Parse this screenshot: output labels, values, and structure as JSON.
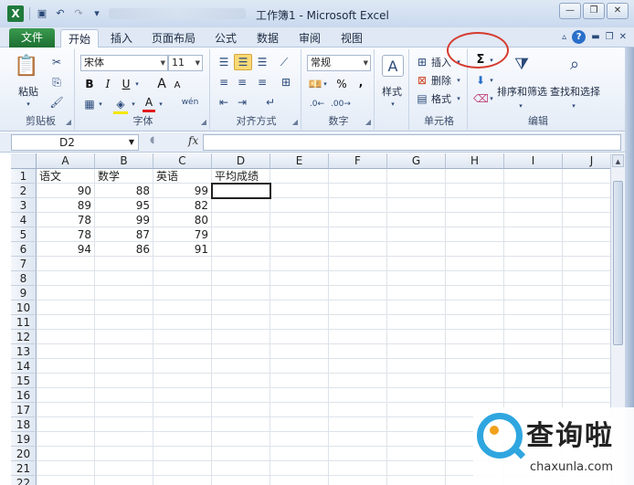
{
  "window": {
    "title": "工作簿1 - Microsoft Excel",
    "app_icon": "X",
    "controls": {
      "minimize": "—",
      "restore": "❐",
      "close": "✕"
    }
  },
  "tabs": {
    "file": "文件",
    "items": [
      "开始",
      "插入",
      "页面布局",
      "公式",
      "数据",
      "审阅",
      "视图"
    ],
    "active": "开始"
  },
  "ribbon": {
    "clipboard": {
      "label": "剪贴板",
      "paste": "粘贴"
    },
    "font": {
      "label": "字体",
      "font_name": "宋体",
      "font_size": "11",
      "bold": "B",
      "italic": "I",
      "underline": "U",
      "grow": "A",
      "shrink": "A",
      "font_color": "A",
      "phonetic": "wén"
    },
    "alignment": {
      "label": "对齐方式"
    },
    "number": {
      "label": "数字",
      "format": "常规",
      "percent": "%",
      "comma": ","
    },
    "styles": {
      "label": "样式"
    },
    "cells": {
      "label": "单元格",
      "insert": "插入",
      "delete": "删除",
      "format": "格式"
    },
    "editing": {
      "label": "编辑",
      "sum_symbol": "Σ",
      "sort_filter": "排序和筛选",
      "find_select": "查找和选择"
    }
  },
  "formula_bar": {
    "name_box": "D2",
    "fx": "fx",
    "value": ""
  },
  "grid": {
    "columns": [
      "A",
      "B",
      "C",
      "D",
      "E",
      "F",
      "G",
      "H",
      "I",
      "J"
    ],
    "rows": [
      "1",
      "2",
      "3",
      "4",
      "5",
      "6",
      "7",
      "8",
      "9",
      "10",
      "11",
      "12",
      "13",
      "14",
      "15",
      "16",
      "17",
      "18",
      "19",
      "20",
      "21",
      "22"
    ],
    "header_row": [
      "语文",
      "数学",
      "英语",
      "平均成绩"
    ],
    "data": [
      [
        90,
        88,
        99
      ],
      [
        89,
        95,
        82
      ],
      [
        78,
        99,
        80
      ],
      [
        78,
        87,
        79
      ],
      [
        94,
        86,
        91
      ]
    ],
    "selected_cell": "D2"
  },
  "watermark": {
    "brand": "查询啦",
    "url": "chaxunla.com"
  },
  "colors": {
    "file_tab": "#1d6f32",
    "annotation_circle": "#d63a2f",
    "watermark_blue": "#2fa6e0"
  }
}
